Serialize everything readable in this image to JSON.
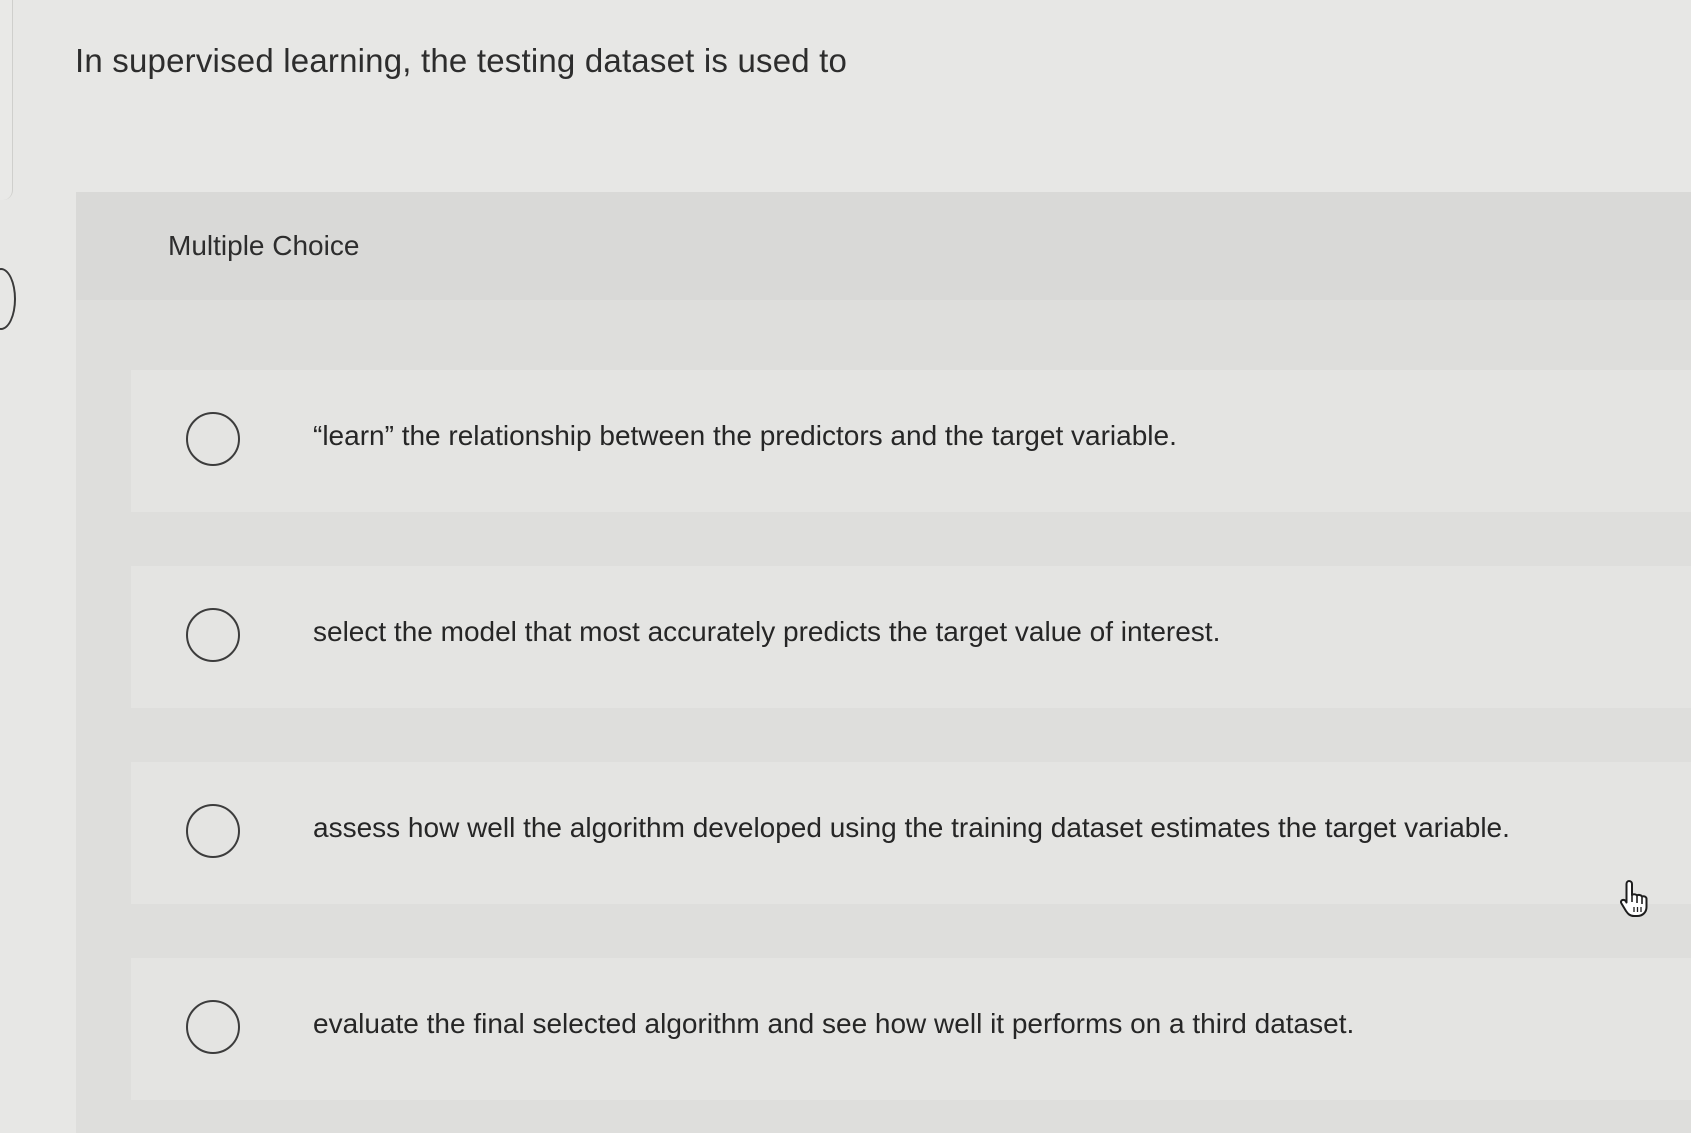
{
  "question": {
    "prompt": "In supervised learning, the testing dataset is used to"
  },
  "choices": {
    "type_label": "Multiple Choice",
    "options": [
      {
        "label": "“learn” the relationship between the predictors and the target variable.",
        "selected": false
      },
      {
        "label": "select the model that most accurately predicts the target value of interest.",
        "selected": false
      },
      {
        "label": "assess how well the algorithm developed using the training dataset estimates the target variable.",
        "selected": false
      },
      {
        "label": "evaluate the final selected algorithm and see how well it performs on a third dataset.",
        "selected": false
      }
    ]
  },
  "icons": {
    "radio": "radio-unselected-icon",
    "cursor": "hand-pointer-icon"
  },
  "colors": {
    "background": "#e7e7e5",
    "panel": "#dededc",
    "option": "#e4e4e2",
    "text": "#2b2b2b"
  }
}
